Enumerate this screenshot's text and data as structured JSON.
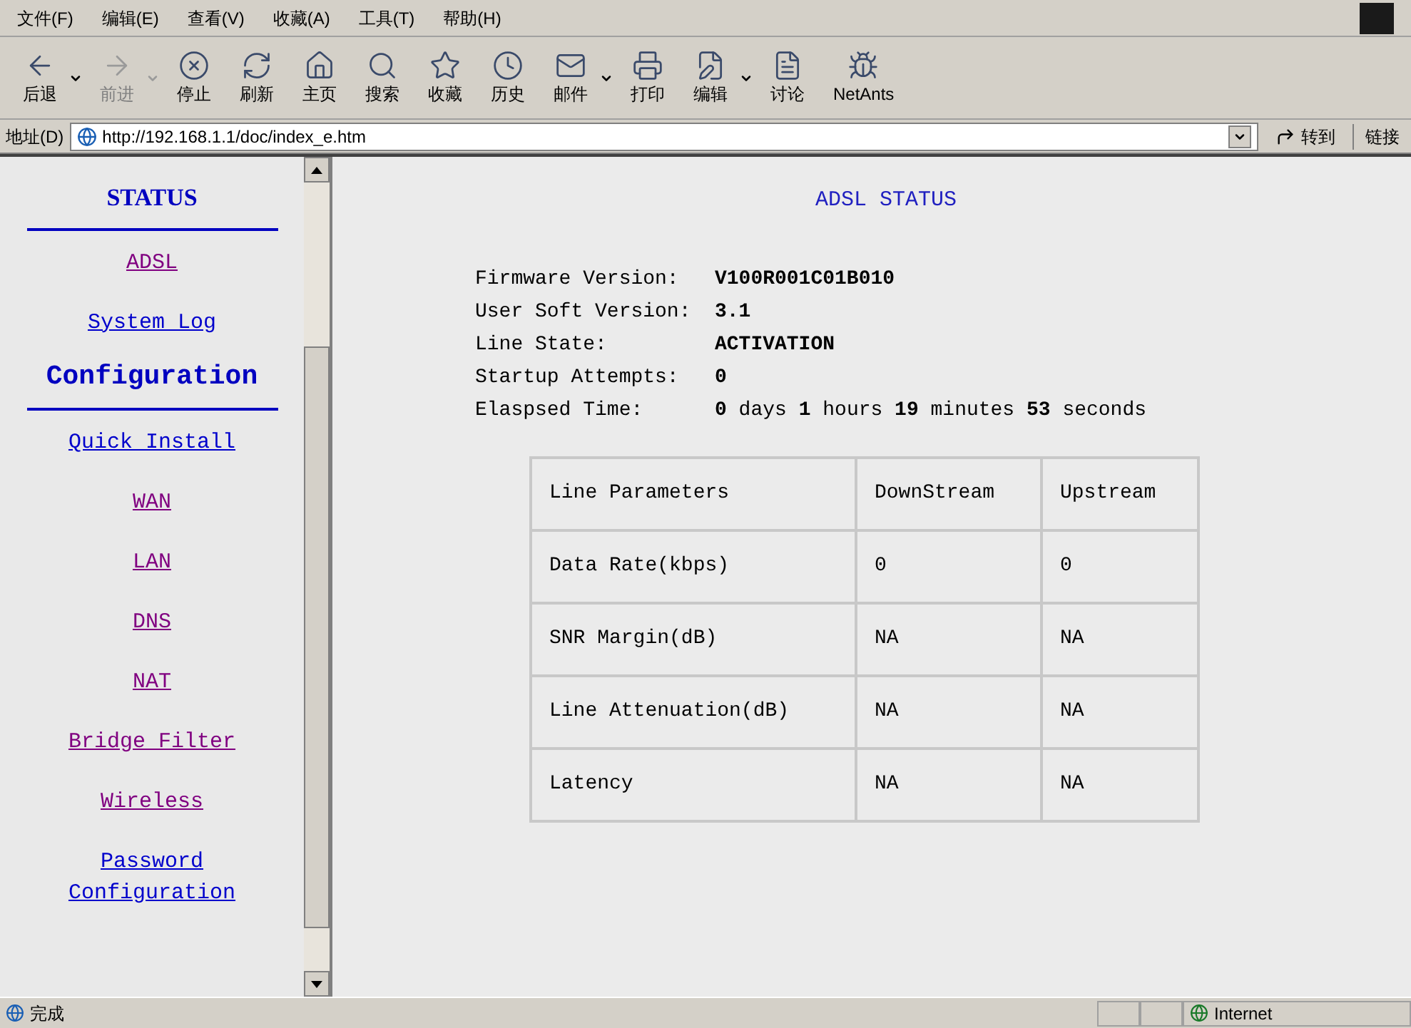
{
  "menu_bar": [
    {
      "label": "文件(F)"
    },
    {
      "label": "编辑(E)"
    },
    {
      "label": "查看(V)"
    },
    {
      "label": "收藏(A)"
    },
    {
      "label": "工具(T)"
    },
    {
      "label": "帮助(H)"
    }
  ],
  "toolbar": [
    {
      "label": "后退",
      "kind": "back",
      "disabled": false,
      "dropdown": true
    },
    {
      "label": "前进",
      "kind": "forward",
      "disabled": true,
      "dropdown": true
    },
    {
      "label": "停止",
      "kind": "stop",
      "disabled": false,
      "dropdown": false
    },
    {
      "label": "刷新",
      "kind": "refresh",
      "disabled": false,
      "dropdown": false
    },
    {
      "label": "主页",
      "kind": "home",
      "disabled": false,
      "dropdown": false
    },
    {
      "label": "搜索",
      "kind": "search",
      "disabled": false,
      "dropdown": false
    },
    {
      "label": "收藏",
      "kind": "favorites",
      "disabled": false,
      "dropdown": false
    },
    {
      "label": "历史",
      "kind": "history",
      "disabled": false,
      "dropdown": false
    },
    {
      "label": "邮件",
      "kind": "mail",
      "disabled": false,
      "dropdown": true
    },
    {
      "label": "打印",
      "kind": "print",
      "disabled": false,
      "dropdown": false
    },
    {
      "label": "编辑",
      "kind": "edit",
      "disabled": false,
      "dropdown": true
    },
    {
      "label": "讨论",
      "kind": "discuss",
      "disabled": false,
      "dropdown": false
    },
    {
      "label": "NetAnts",
      "kind": "ant",
      "disabled": false,
      "dropdown": false
    }
  ],
  "address_bar": {
    "label": "地址(D)",
    "value": "http://192.168.1.1/doc/index_e.htm",
    "go": "转到",
    "links": "链接"
  },
  "sidebar": {
    "sections": [
      {
        "title": "STATUS",
        "items": [
          {
            "label": "ADSL",
            "visited": true
          },
          {
            "label": "System Log",
            "visited": false
          }
        ]
      },
      {
        "title": "Configuration",
        "items": [
          {
            "label": "Quick Install",
            "visited": false
          },
          {
            "label": "WAN",
            "visited": true
          },
          {
            "label": "LAN",
            "visited": true
          },
          {
            "label": "DNS",
            "visited": true
          },
          {
            "label": "NAT",
            "visited": true
          },
          {
            "label": "Bridge Filter",
            "visited": true
          },
          {
            "label": "Wireless",
            "visited": true
          },
          {
            "label": "Password Configuration",
            "visited": false
          }
        ]
      }
    ]
  },
  "main": {
    "title": "ADSL STATUS",
    "fields": [
      {
        "label": "Firmware Version:",
        "value": "**V100R001C01B010**"
      },
      {
        "label": "User Soft Version:",
        "value": "**3.1**"
      },
      {
        "label": "Line State:",
        "value": "**ACTIVATION**"
      },
      {
        "label": "Startup Attempts:",
        "value": "**0**"
      },
      {
        "label": "Elaspsed Time:",
        "value": "**0** days **1** hours **19** minutes **53** seconds"
      }
    ],
    "table": {
      "columns": [
        "Line Parameters",
        "DownStream",
        "Upstream"
      ],
      "rows": [
        [
          "Data Rate(kbps)",
          "0",
          "0"
        ],
        [
          "SNR Margin(dB)",
          "NA",
          "NA"
        ],
        [
          "Line Attenuation(dB)",
          "NA",
          "NA"
        ],
        [
          "Latency",
          "NA",
          "NA"
        ]
      ]
    }
  },
  "status_bar": {
    "text": "完成",
    "zone": "Internet"
  }
}
